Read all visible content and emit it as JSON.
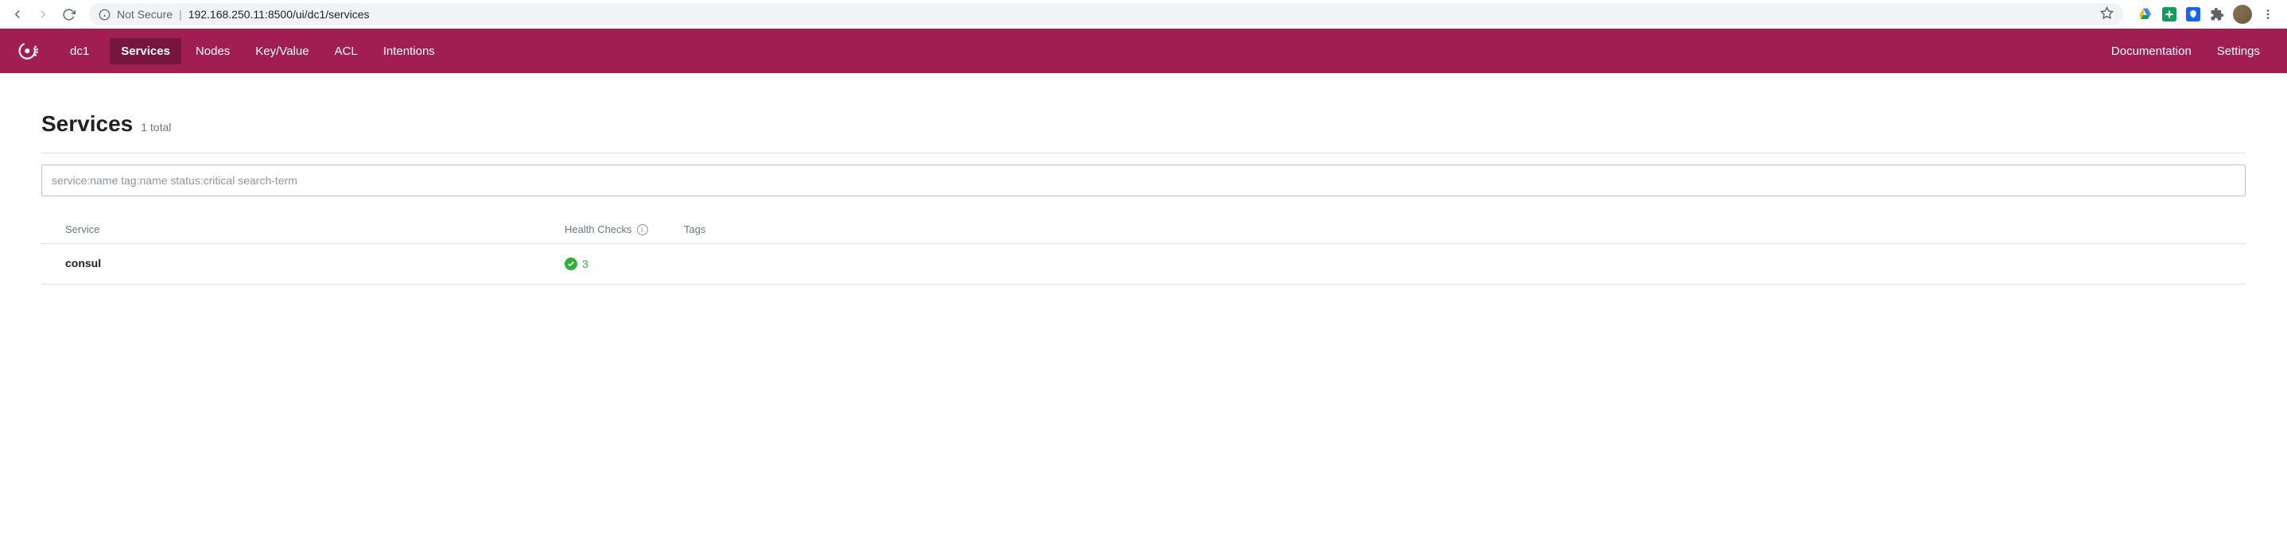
{
  "browser": {
    "not_secure_label": "Not Secure",
    "url": "192.168.250.11:8500/ui/dc1/services"
  },
  "nav": {
    "datacenter": "dc1",
    "items": [
      "Services",
      "Nodes",
      "Key/Value",
      "ACL",
      "Intentions"
    ],
    "active_index": 0,
    "right_items": [
      "Documentation",
      "Settings"
    ]
  },
  "page": {
    "title": "Services",
    "count_label": "1 total"
  },
  "search": {
    "placeholder": "service:name tag:name status:critical search-term",
    "value": ""
  },
  "table": {
    "headers": {
      "service": "Service",
      "health": "Health Checks",
      "tags": "Tags"
    },
    "rows": [
      {
        "name": "consul",
        "health_count": "3",
        "health_status": "passing",
        "tags": ""
      }
    ]
  }
}
